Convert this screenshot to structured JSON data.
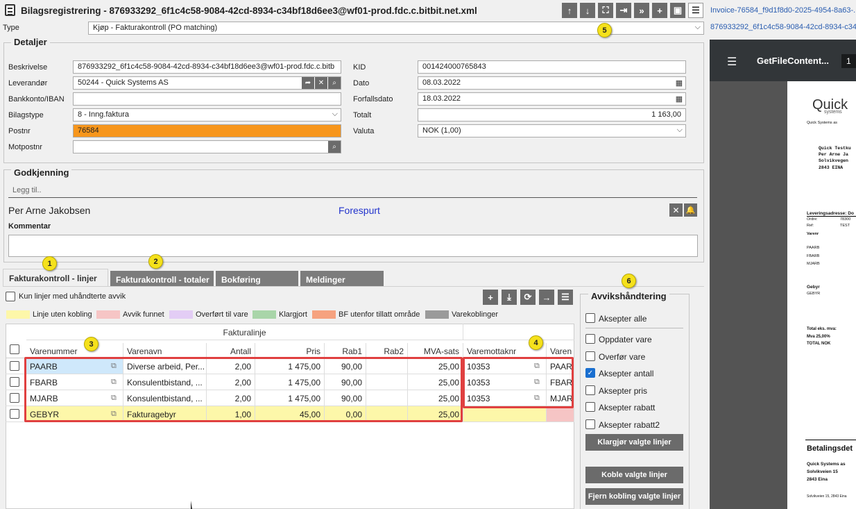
{
  "header": {
    "title": "Bilagsregistrering - 876933292_6f1c4c58-9084-42cd-8934-c34bf18d6ee3@wf01-prod.fdc.c.bitbit.net.xml",
    "right_link_1": "Invoice-76584_f9d1f8d0-2025-4954-8a63-...",
    "right_link_2": "876933292_6f1c4c58-9084-42cd-8934-c34..."
  },
  "type_row": {
    "label": "Type",
    "value": "Kjøp - Fakturakontroll (PO matching)"
  },
  "details": {
    "legend": "Detaljer",
    "beskrivelse": {
      "label": "Beskrivelse",
      "value": "876933292_6f1c4c58-9084-42cd-8934-c34bf18d6ee3@wf01-prod.fdc.c.bitb"
    },
    "leverandor": {
      "label": "Leverandør",
      "value": "50244 - Quick Systems AS"
    },
    "bankkonto": {
      "label": "Bankkonto/IBAN",
      "value": ""
    },
    "bilagstype": {
      "label": "Bilagstype",
      "value": "8 - Inng.faktura"
    },
    "postnr": {
      "label": "Postnr",
      "value": "76584"
    },
    "motpostnr": {
      "label": "Motpostnr",
      "value": ""
    },
    "kid": {
      "label": "KID",
      "value": "001424000765843"
    },
    "dato": {
      "label": "Dato",
      "value": "08.03.2022"
    },
    "forfallsdato": {
      "label": "Forfallsdato",
      "value": "18.03.2022"
    },
    "totalt": {
      "label": "Totalt",
      "value": "1 163,00"
    },
    "valuta": {
      "label": "Valuta",
      "value": "NOK (1,00)"
    }
  },
  "approval": {
    "legend": "Godkjenning",
    "add_placeholder": "Legg til..",
    "approver": "Per Arne Jakobsen",
    "status": "Forespurt",
    "comment_label": "Kommentar",
    "comment_value": ""
  },
  "tabs": [
    "Fakturakontroll - linjer",
    "Fakturakontroll - totaler",
    "Bokføring",
    "Meldinger"
  ],
  "markers": [
    "1",
    "2",
    "3",
    "4",
    "5",
    "6"
  ],
  "filter": {
    "label": "Kun linjer med uhåndterte avvik"
  },
  "legend_items": [
    {
      "label": "Linje uten kobling",
      "color": "#fdf7a9"
    },
    {
      "label": "Avvik funnet",
      "color": "#f6c5c5"
    },
    {
      "label": "Overført til vare",
      "color": "#e3cdf5"
    },
    {
      "label": "Klargjort",
      "color": "#a9d5a9"
    },
    {
      "label": "BF utenfor tillatt område",
      "color": "#f6a27f"
    },
    {
      "label": "Varekoblinger",
      "color": "#9a9a9a"
    }
  ],
  "grid": {
    "group_header": "Fakturalinje",
    "columns": [
      "Varenummer",
      "Varenavn",
      "Antall",
      "Pris",
      "Rab1",
      "Rab2",
      "MVA-sats",
      "Varemottaknr",
      "Varen"
    ],
    "rows": [
      {
        "varenummer": "PAARB",
        "varenavn": "Diverse arbeid, Per...",
        "antall": "2,00",
        "pris": "1 475,00",
        "rab1": "90,00",
        "rab2": "",
        "mva": "25,00",
        "mottak": "10353",
        "varen": "PAAR"
      },
      {
        "varenummer": "FBARB",
        "varenavn": "Konsulentbistand, ...",
        "antall": "2,00",
        "pris": "1 475,00",
        "rab1": "90,00",
        "rab2": "",
        "mva": "25,00",
        "mottak": "10353",
        "varen": "FBAR"
      },
      {
        "varenummer": "MJARB",
        "varenavn": "Konsulentbistand, ...",
        "antall": "2,00",
        "pris": "1 475,00",
        "rab1": "90,00",
        "rab2": "",
        "mva": "25,00",
        "mottak": "10353",
        "varen": "MJAR"
      },
      {
        "varenummer": "GEBYR",
        "varenavn": "Fakturagebyr",
        "antall": "1,00",
        "pris": "45,00",
        "rab1": "0,00",
        "rab2": "",
        "mva": "25,00",
        "mottak": "",
        "varen": ""
      }
    ]
  },
  "deviation": {
    "legend": "Avvikshåndtering",
    "accept_all": "Aksepter alle",
    "options": [
      {
        "label": "Oppdater vare",
        "checked": false
      },
      {
        "label": "Overfør vare",
        "checked": false
      },
      {
        "label": "Aksepter antall",
        "checked": true
      },
      {
        "label": "Aksepter pris",
        "checked": false
      },
      {
        "label": "Aksepter rabatt",
        "checked": false
      },
      {
        "label": "Aksepter rabatt2",
        "checked": false
      }
    ],
    "btn_prepare": "Klargjør valgte linjer",
    "btn_link": "Koble valgte linjer",
    "btn_unlink": "Fjern kobling valgte linjer"
  },
  "viewer": {
    "title": "GetFileContent...",
    "page": "1",
    "logo": "Quick",
    "logo_sub": "systems",
    "company_small": "Quick Systems as",
    "addr": [
      "Quick Testku",
      "Per Arne Ja",
      "Solvikvegen",
      "2843 EINA"
    ],
    "leveringsadresse": "Leveringsadresse: Do",
    "ordre_label": "Ordre:",
    "ordre_value": "78300",
    "ref_label": "Ref:",
    "ref_value": "TEST",
    "varer_label": "Varenr",
    "items": [
      "PAARB",
      "FBARB",
      "MJARB"
    ],
    "gebyr_head": "Gebyr",
    "gebyr_item": "GEBYR",
    "total_eks": "Total eks. mva:",
    "mva": "Mva 25,00%",
    "total_nok": "TOTAL NOK",
    "betaling": "Betalingsdet",
    "pay_lines": [
      "Quick Systems as",
      "Solvikveien 15",
      "2843 Eina"
    ],
    "footer": "Solvikveien 15, 2843 Eina"
  }
}
